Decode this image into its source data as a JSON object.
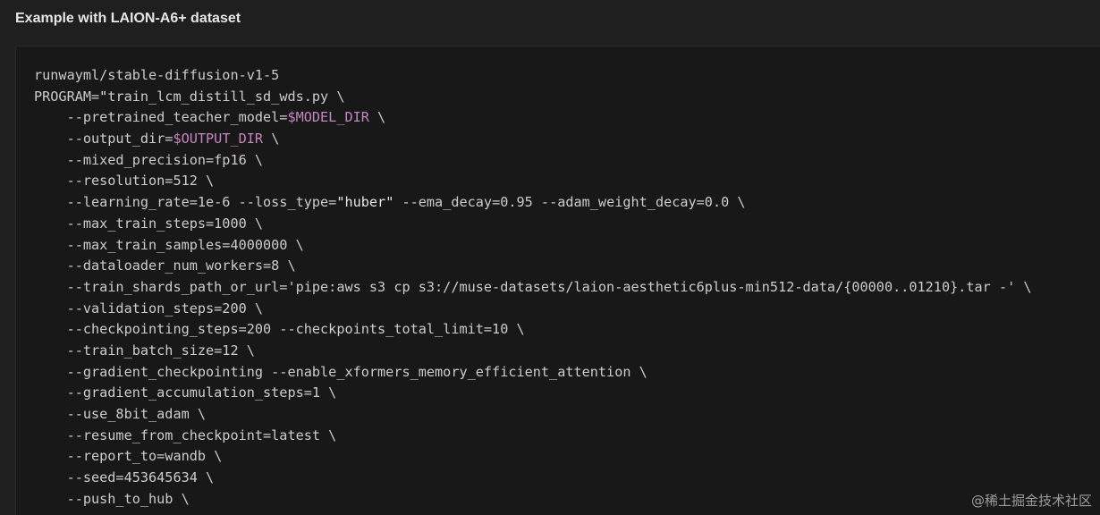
{
  "section": {
    "heading": "Example with LAION-A6+ dataset"
  },
  "code": {
    "lines": [
      [
        {
          "t": "runwayml/stable-diffusion-v1-5",
          "c": "plain"
        }
      ],
      [
        {
          "t": "PROGRAM=",
          "c": "plain"
        },
        {
          "t": "\"",
          "c": "str"
        },
        {
          "t": "train_lcm_distill_sd_wds.py \\",
          "c": "plain"
        }
      ],
      [
        {
          "t": "    --pretrained_teacher_model=",
          "c": "plain"
        },
        {
          "t": "$MODEL_DIR",
          "c": "var"
        },
        {
          "t": " \\",
          "c": "plain"
        }
      ],
      [
        {
          "t": "    --output_dir=",
          "c": "plain"
        },
        {
          "t": "$OUTPUT_DIR",
          "c": "var"
        },
        {
          "t": " \\",
          "c": "plain"
        }
      ],
      [
        {
          "t": "    --mixed_precision=fp16 \\",
          "c": "plain"
        }
      ],
      [
        {
          "t": "    --resolution=512 \\",
          "c": "plain"
        }
      ],
      [
        {
          "t": "    --learning_rate=1e-6 --loss_type=",
          "c": "plain"
        },
        {
          "t": "\"huber\"",
          "c": "str"
        },
        {
          "t": " --ema_decay=0.95 --adam_weight_decay=0.0 \\",
          "c": "plain"
        }
      ],
      [
        {
          "t": "    --max_train_steps=1000 \\",
          "c": "plain"
        }
      ],
      [
        {
          "t": "    --max_train_samples=4000000 \\",
          "c": "plain"
        }
      ],
      [
        {
          "t": "    --dataloader_num_workers=8 \\",
          "c": "plain"
        }
      ],
      [
        {
          "t": "    --train_shards_path_or_url='pipe:aws s3 cp s3://muse-datasets/laion-aesthetic6plus-min512-data/{00000..01210}.tar -' \\",
          "c": "plain"
        }
      ],
      [
        {
          "t": "    --validation_steps=200 \\",
          "c": "plain"
        }
      ],
      [
        {
          "t": "    --checkpointing_steps=200 --checkpoints_total_limit=10 \\",
          "c": "plain"
        }
      ],
      [
        {
          "t": "    --train_batch_size=12 \\",
          "c": "plain"
        }
      ],
      [
        {
          "t": "    --gradient_checkpointing --enable_xformers_memory_efficient_attention \\",
          "c": "plain"
        }
      ],
      [
        {
          "t": "    --gradient_accumulation_steps=1 \\",
          "c": "plain"
        }
      ],
      [
        {
          "t": "    --use_8bit_adam \\",
          "c": "plain"
        }
      ],
      [
        {
          "t": "    --resume_from_checkpoint=latest \\",
          "c": "plain"
        }
      ],
      [
        {
          "t": "    --report_to=wandb \\",
          "c": "plain"
        }
      ],
      [
        {
          "t": "    --seed=453645634 \\",
          "c": "plain"
        }
      ],
      [
        {
          "t": "    --push_to_hub \\",
          "c": "plain"
        }
      ]
    ]
  },
  "watermark": {
    "text": "@稀土掘金技术社区"
  },
  "colors": {
    "background": "#1f1f1f",
    "code_background": "#181818",
    "code_text": "#cccccc",
    "variable": "#c586c0",
    "string": "#e8e8e8"
  }
}
